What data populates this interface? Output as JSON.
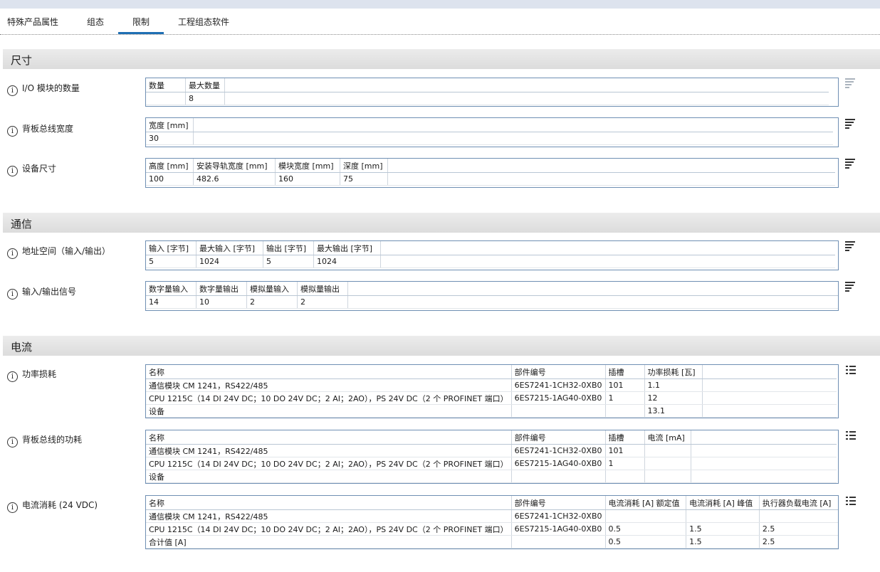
{
  "tabs": [
    {
      "label": "特殊产品属性"
    },
    {
      "label": "组态"
    },
    {
      "label": "限制"
    },
    {
      "label": "工程组态软件"
    }
  ],
  "sections": {
    "size": "尺寸",
    "comm": "通信",
    "current": "电流"
  },
  "rows": {
    "io_count": {
      "label": "I/O 模块的数量",
      "headers": [
        "数量",
        "最大数量"
      ],
      "values": [
        "",
        "8"
      ]
    },
    "backplane_width": {
      "label": "背板总线宽度",
      "headers": [
        "宽度 [mm]"
      ],
      "values": [
        "30"
      ]
    },
    "device_size": {
      "label": "设备尺寸",
      "headers": [
        "高度 [mm]",
        "安装导轨宽度 [mm]",
        "模块宽度 [mm]",
        "深度 [mm]"
      ],
      "values": [
        "100",
        "482.6",
        "160",
        "75"
      ]
    },
    "address_space": {
      "label": "地址空间（输入/输出）",
      "headers": [
        "输入 [字节]",
        "最大输入 [字节]",
        "输出 [字节]",
        "最大输出 [字节]"
      ],
      "values": [
        "5",
        "1024",
        "5",
        "1024"
      ]
    },
    "io_signals": {
      "label": "输入/输出信号",
      "headers": [
        "数字量输入",
        "数字量输出",
        "模拟量输入",
        "模拟量输出"
      ],
      "values": [
        "14",
        "10",
        "2",
        "2"
      ]
    },
    "power_loss": {
      "label": "功率损耗",
      "headers": [
        "名称",
        "部件编号",
        "插槽",
        "功率损耗 [瓦]"
      ],
      "rows": [
        [
          "通信模块 CM 1241，RS422/485",
          "6ES7241-1CH32-0XB0",
          "101",
          "1.1"
        ],
        [
          "CPU 1215C（14 DI 24V DC；10 DO 24V DC；2 AI；2AO），PS 24V DC（2 个 PROFINET 端口）",
          "6ES7215-1AG40-0XB0",
          "1",
          "12"
        ],
        [
          "设备",
          "",
          "",
          "13.1"
        ]
      ]
    },
    "backplane_power": {
      "label": "背板总线的功耗",
      "headers": [
        "名称",
        "部件编号",
        "插槽",
        "电流 [mA]"
      ],
      "rows": [
        [
          "通信模块 CM 1241，RS422/485",
          "6ES7241-1CH32-0XB0",
          "101",
          ""
        ],
        [
          "CPU 1215C（14 DI 24V DC；10 DO 24V DC；2 AI；2AO），PS 24V DC（2 个 PROFINET 端口）",
          "6ES7215-1AG40-0XB0",
          "1",
          ""
        ],
        [
          "设备",
          "",
          "",
          ""
        ]
      ]
    },
    "current_24v": {
      "label": "电流消耗 (24 VDC)",
      "headers": [
        "名称",
        "部件编号",
        "电流消耗 [A] 额定值",
        "电流消耗 [A] 峰值",
        "执行器负载电流 [A]"
      ],
      "rows": [
        [
          "通信模块 CM 1241，RS422/485",
          "6ES7241-1CH32-0XB0",
          "",
          "",
          ""
        ],
        [
          "CPU 1215C（14 DI 24V DC；10 DO 24V DC；2 AI；2AO），PS 24V DC（2 个 PROFINET 端口）",
          "6ES7215-1AG40-0XB0",
          "0.5",
          "1.5",
          "2.5"
        ],
        [
          "合计值 [A]",
          "",
          "0.5",
          "1.5",
          "2.5"
        ]
      ]
    }
  },
  "icons": {
    "info": "i"
  },
  "colors": {
    "accent": "#1f6fb3",
    "table_border": "#6f8fb3"
  }
}
